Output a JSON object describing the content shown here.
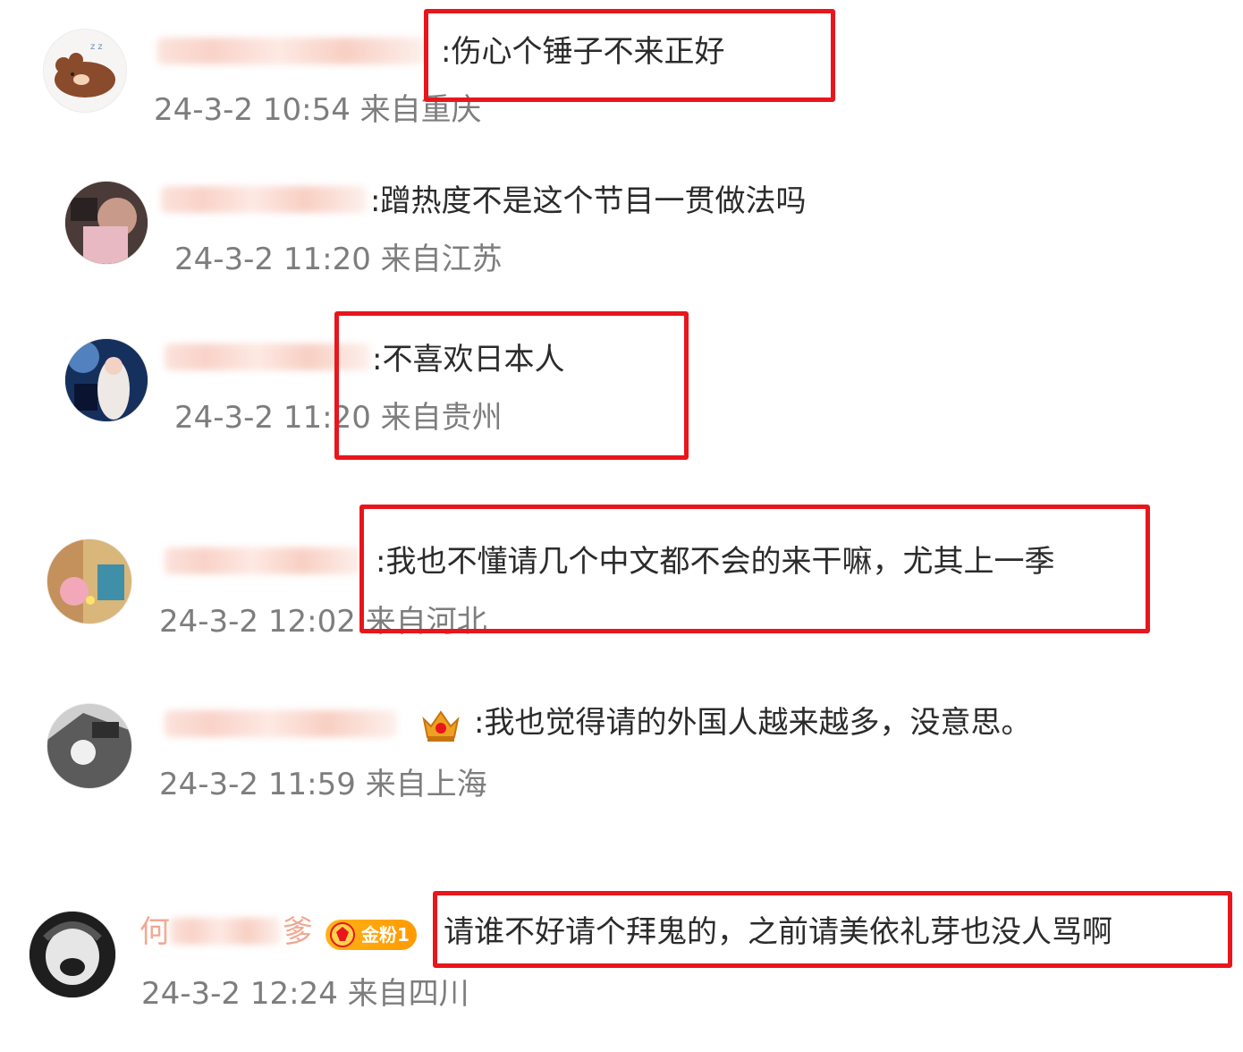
{
  "comments": [
    {
      "text": ":伤心个锤子不来正好",
      "meta": "24-3-2 10:54 来自重庆"
    },
    {
      "text": ":蹭热度不是这个节目一贯做法吗",
      "meta": "24-3-2 11:20 来自江苏"
    },
    {
      "text": ":不喜欢日本人",
      "meta": "24-3-2 11:20 来自贵州"
    },
    {
      "text": ":我也不懂请几个中文都不会的来干嘛，尤其上一季",
      "meta": "24-3-2 12:02 来自河北"
    },
    {
      "text": ":我也觉得请的外国人越来越多，没意思。",
      "meta": "24-3-2 11:59 来自上海"
    },
    {
      "text": "请谁不好请个拜鬼的，之前请美依礼芽也没人骂啊",
      "meta": "24-3-2 12:24 来自四川",
      "badge": "金粉1",
      "name_start": "何",
      "name_end": "爹"
    }
  ],
  "colors": {
    "highlight": "#e8161c",
    "meta": "#7d7d7d",
    "text": "#2b2b2b"
  }
}
